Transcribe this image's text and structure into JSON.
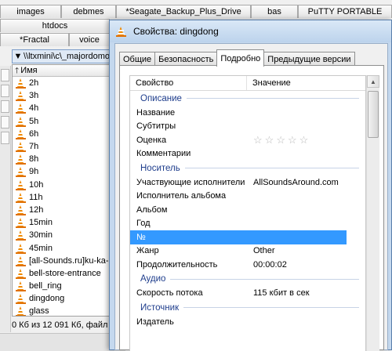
{
  "tabs_row1": [
    "images",
    "debmes",
    "*Seagate_Backup_Plus_Drive",
    "bas",
    "PuTTY PORTABLE"
  ],
  "tabs_row2": [
    "htdocs"
  ],
  "tabs_row3": [
    "*Fractal",
    "voice"
  ],
  "path": "\\\\ltxmini\\c\\_majordomo",
  "column_name": "Имя",
  "files": [
    "2h",
    "3h",
    "4h",
    "5h",
    "6h",
    "7h",
    "8h",
    "9h",
    "10h",
    "11h",
    "12h",
    "15min",
    "30min",
    "45min",
    "[all-Sounds.ru]ku-ka-",
    "bell-store-entrance",
    "bell_ring",
    "dingdong",
    "glass"
  ],
  "status_text": "0 Кб из 12 091 Кб, файл",
  "dialog": {
    "title": "Свойства: dingdong",
    "tabs": [
      "Общие",
      "Безопасность",
      "Подробно",
      "Предыдущие версии"
    ],
    "active_tab": "Подробно",
    "col_property": "Свойство",
    "col_value": "Значение",
    "rows": [
      {
        "type": "group",
        "label": "Описание"
      },
      {
        "type": "prop",
        "key": "Название",
        "value": ""
      },
      {
        "type": "prop",
        "key": "Субтитры",
        "value": ""
      },
      {
        "type": "rating",
        "key": "Оценка",
        "stars": 0
      },
      {
        "type": "prop",
        "key": "Комментарии",
        "value": ""
      },
      {
        "type": "group",
        "label": "Носитель"
      },
      {
        "type": "prop",
        "key": "Участвующие исполнители",
        "value": "AllSoundsAround.com"
      },
      {
        "type": "prop",
        "key": "Исполнитель альбома",
        "value": ""
      },
      {
        "type": "prop",
        "key": "Альбом",
        "value": ""
      },
      {
        "type": "prop",
        "key": "Год",
        "value": ""
      },
      {
        "type": "prop",
        "key": "№",
        "value": "",
        "selected": true
      },
      {
        "type": "prop",
        "key": "Жанр",
        "value": "Other"
      },
      {
        "type": "prop",
        "key": "Продолжительность",
        "value": "00:00:02"
      },
      {
        "type": "group",
        "label": "Аудио"
      },
      {
        "type": "prop",
        "key": "Скорость потока",
        "value": "115 кбит в сек"
      },
      {
        "type": "group",
        "label": "Источник"
      },
      {
        "type": "prop",
        "key": "Издатель",
        "value": ""
      }
    ]
  }
}
